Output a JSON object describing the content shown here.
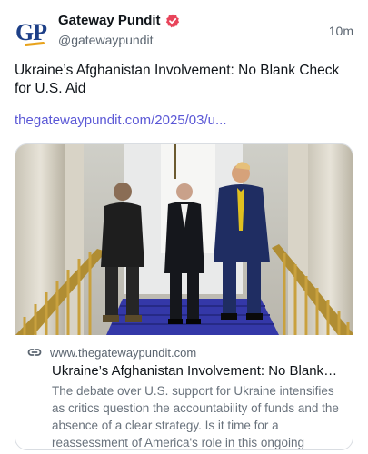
{
  "author": {
    "avatar_text": "GP",
    "display_name": "Gateway Pundit",
    "handle": "@gatewaypundit",
    "verified_icon": "verified-badge-icon",
    "avatar_colors": {
      "letters": "#1d3f87",
      "swoosh": "#e8a21a"
    }
  },
  "post": {
    "timestamp": "10m",
    "text": "Ukraine’s Afghanistan Involvement: No Blank Check for U.S. Aid",
    "link_text": "thegatewaypundit.com/2025/03/u...",
    "link_color": "#5b58d6"
  },
  "link_card": {
    "link_icon": "link-icon",
    "domain": "www.thegatewaypundit.com",
    "title": "Ukraine’s Afghanistan Involvement: No Blank C...",
    "description": "The debate over U.S. support for Ukraine intensifies as critics question the accountability of funds and the absence of a clear strategy. Is it time for a reassessment of America's role in this ongoing conflict?"
  }
}
